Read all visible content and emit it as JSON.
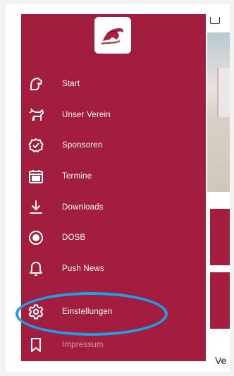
{
  "menu": {
    "items": [
      {
        "icon": "horse-head-icon",
        "label": "Start"
      },
      {
        "icon": "horse-icon",
        "label": "Unser Verein"
      },
      {
        "icon": "handshake-icon",
        "label": "Sponsoren"
      },
      {
        "icon": "calendar-icon",
        "label": "Termine"
      },
      {
        "icon": "download-icon",
        "label": "Downloads"
      },
      {
        "icon": "radio-circle-icon",
        "label": "DOSB"
      },
      {
        "icon": "bell-icon",
        "label": "Push News"
      },
      {
        "icon": "gear-icon",
        "label": "Einstellungen"
      },
      {
        "icon": "bookmark-icon",
        "label": "Impressum"
      }
    ]
  },
  "content": {
    "partial_text": "Ve"
  },
  "colors": {
    "drawer": "#a31e3e",
    "highlight": "#1ea0e6"
  }
}
